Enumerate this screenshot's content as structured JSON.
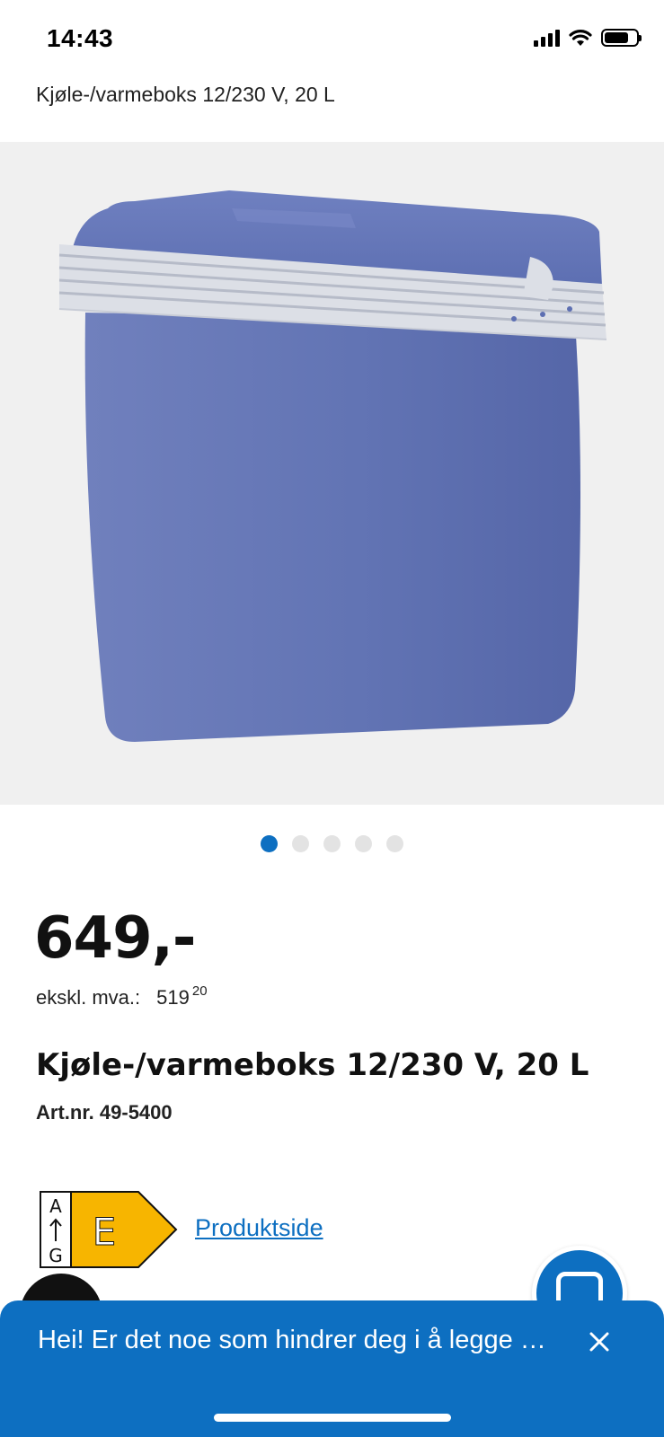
{
  "status_bar": {
    "time": "14:43",
    "signal_icon": "signal-bars-icon",
    "wifi_icon": "wifi-icon",
    "battery_icon": "battery-icon",
    "battery_level": 0.75
  },
  "header": {
    "title": "Kjøle-/varmeboks 12/230 V, 20 L"
  },
  "gallery": {
    "image_icon": "cooler-box-image",
    "image_count": 5,
    "active_index": 0
  },
  "product": {
    "price": "649,-",
    "vat_label": "ekskl. mva.:",
    "vat_main": "519",
    "vat_decimal": "20",
    "title": "Kjøle-/varmeboks 12/230 V, 20 L",
    "artnr": "Art.nr. 49-5400"
  },
  "energy_label": {
    "scale_top": "A",
    "scale_bottom": "G",
    "class": "E",
    "color": "#f7b500",
    "link_text": "Produktside"
  },
  "colors": {
    "accent": "#0d6fc1",
    "cooler_blue": "#6677b6",
    "dot_inactive": "#e3e3e3"
  },
  "chat": {
    "icon": "chat-icon"
  },
  "banner": {
    "text": "Hei! Er det noe som hindrer deg i å legge …",
    "close_icon": "close-icon"
  }
}
